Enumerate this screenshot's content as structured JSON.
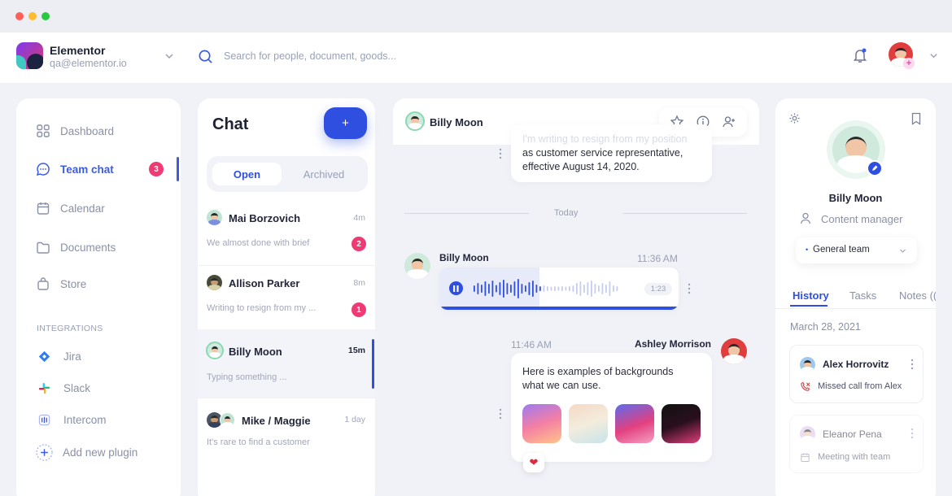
{
  "app": {
    "name": "Elementor",
    "email": "qa@elementor.io"
  },
  "search": {
    "placeholder": "Search for people, document, goods..."
  },
  "sidebar": {
    "items": [
      {
        "label": "Dashboard",
        "icon": "grid-icon"
      },
      {
        "label": "Team chat",
        "icon": "chat-icon",
        "badge": "3"
      },
      {
        "label": "Calendar",
        "icon": "calendar-icon"
      },
      {
        "label": "Documents",
        "icon": "folder-icon"
      },
      {
        "label": "Store",
        "icon": "bag-icon"
      }
    ],
    "integrations_heading": "INTEGRATIONS",
    "integrations": [
      {
        "label": "Jira",
        "icon": "jira-icon"
      },
      {
        "label": "Slack",
        "icon": "slack-icon"
      },
      {
        "label": "Intercom",
        "icon": "intercom-icon"
      },
      {
        "label": "Add new plugin",
        "icon": "plus-icon"
      }
    ]
  },
  "chat_list": {
    "title": "Chat",
    "new_button": "+",
    "tabs": [
      "Open",
      "Archived"
    ],
    "rows": [
      {
        "name": "Mai Borzovich",
        "time": "4m",
        "preview": "We almost done with brief",
        "unread": "2"
      },
      {
        "name": "Allison Parker",
        "time": "8m",
        "preview": "Writing to resign from my ...",
        "unread": "1"
      },
      {
        "name": "Billy Moon",
        "time": "15m",
        "preview": "Typing something ..."
      },
      {
        "name": "Mike",
        "name2": "Maggie",
        "sep": "/",
        "time": "1 day",
        "preview": "It's rare to find a customer"
      }
    ]
  },
  "conversation": {
    "contact": "Billy Moon",
    "msg1_faded": "I'm writing to resign from my position",
    "msg1": "as customer service representative, effective August 14, 2020.",
    "divider": "Today",
    "voice": {
      "sender": "Billy Moon",
      "time": "11:36 AM",
      "duration": "1:23",
      "played": 0.42
    },
    "msg2": {
      "sender": "Ashley Morrison",
      "time": "11:46 AM",
      "text": "Here is examples of backgrounds what we can use."
    },
    "reaction": "❤"
  },
  "profile": {
    "name": "Billy Moon",
    "role": "Content manager",
    "team": "General team",
    "team_bullet": "•",
    "tabs": [
      "History",
      "Tasks",
      "Notes (("
    ],
    "date": "March 28, 2021",
    "events": [
      {
        "name": "Alex Horrovitz",
        "detail": "Missed call from Alex"
      },
      {
        "name": "Eleanor Pena",
        "detail": "Meeting with team"
      }
    ]
  }
}
